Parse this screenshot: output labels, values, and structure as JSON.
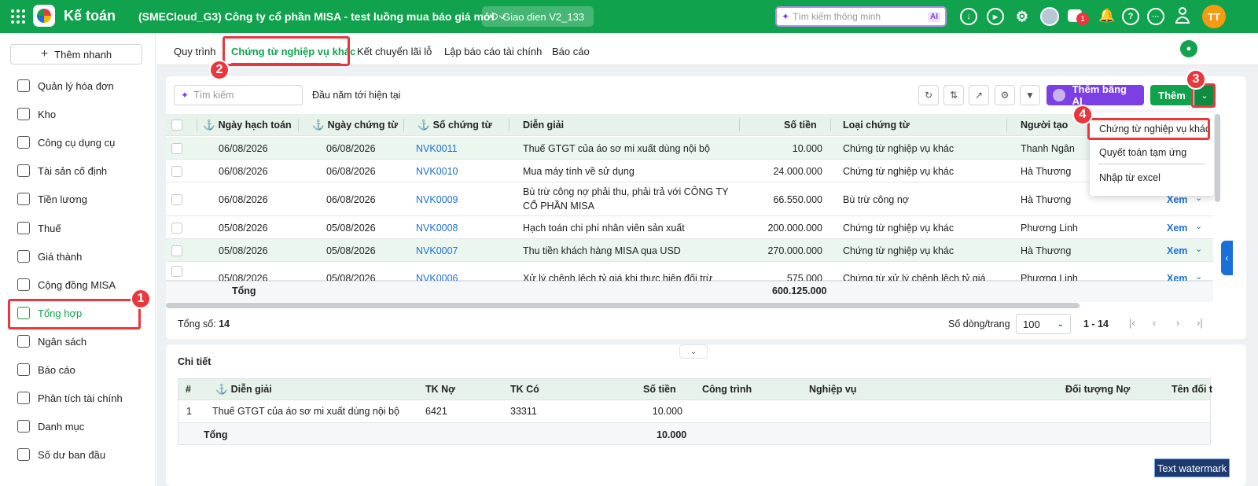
{
  "topbar": {
    "app_title": "Kế toán",
    "company": "(SMECloud_G3) Công ty cổ phần MISA - test luồng mua báo giá mới",
    "version_chip": "Giao dien V2_133",
    "search_placeholder": "Tìm kiếm thông minh",
    "ai_badge": "AI",
    "chat_count": "1",
    "avatar_initials": "TT"
  },
  "sidebar": {
    "quick_add": "Thêm nhanh",
    "items": [
      {
        "label": "Quản lý hóa đơn",
        "icon": "invoice-icon"
      },
      {
        "label": "Kho",
        "icon": "warehouse-icon"
      },
      {
        "label": "Công cụ dụng cụ",
        "icon": "tools-icon"
      },
      {
        "label": "Tài sản cố định",
        "icon": "car-icon"
      },
      {
        "label": "Tiền lương",
        "icon": "dollar-icon"
      },
      {
        "label": "Thuế",
        "icon": "tax-icon"
      },
      {
        "label": "Giá thành",
        "icon": "tag-icon"
      },
      {
        "label": "Cộng đồng MISA",
        "icon": "community-icon"
      },
      {
        "label": "Tổng hợp",
        "icon": "book-icon"
      },
      {
        "label": "Ngân sách",
        "icon": "budget-icon"
      },
      {
        "label": "Báo cáo",
        "icon": "report-icon"
      },
      {
        "label": "Phân tích tài chính",
        "icon": "chart-icon"
      },
      {
        "label": "Danh mục",
        "icon": "list-icon"
      },
      {
        "label": "Số dư ban đầu",
        "icon": "balance-icon"
      }
    ]
  },
  "tabs": [
    "Quy trình",
    "Chứng từ nghiệp vụ khác",
    "Kết chuyển lãi lỗ",
    "Lập báo cáo tài chính",
    "Báo cáo"
  ],
  "toolbar": {
    "search_placeholder": "Tìm kiếm",
    "period": "Đầu năm tới hiện tại",
    "ai_add": "Thêm bằng AI",
    "add": "Thêm"
  },
  "table": {
    "headers": [
      "Ngày hạch toán",
      "Ngày chứng từ",
      "Số chứng từ",
      "Diễn giải",
      "Số tiền",
      "Loại chứng từ",
      "Người tạo"
    ],
    "rows": [
      [
        "06/08/2026",
        "06/08/2026",
        "NVK0011",
        "Thuế GTGT của áo sơ mi xuất dùng nội bộ",
        "",
        "10.000",
        "Chứng từ nghiệp vụ khác",
        "Thanh Ngân"
      ],
      [
        "06/08/2026",
        "06/08/2026",
        "NVK0010",
        "Mua máy tính về sử dụng",
        "",
        "24.000.000",
        "Chứng từ nghiệp vụ khác",
        "Hà Thương"
      ],
      [
        "06/08/2026",
        "06/08/2026",
        "NVK0009",
        "Bù trừ công nợ phải thu, phải trả với CÔNG TY",
        "CỔ PHẦN MISA",
        "66.550.000",
        "Bù trừ công nợ",
        "Hà Thương"
      ],
      [
        "05/08/2026",
        "05/08/2026",
        "NVK0008",
        "Hạch toán chi phí nhân viên sản xuất",
        "",
        "200.000.000",
        "Chứng từ nghiệp vụ khác",
        "Phương Linh"
      ],
      [
        "05/08/2026",
        "05/08/2026",
        "NVK0007",
        "Thu tiền khách hàng MISA qua USD",
        "",
        "270.000.000",
        "Chứng từ nghiệp vụ khác",
        "Hà Thương"
      ],
      [
        "05/08/2026",
        "05/08/2026",
        "NVK0006",
        "Xử lý chênh lệch tỷ giá khi thực hiện đối trừ",
        "",
        "575.000",
        "Chứng từ xử lý chênh lệch tỷ giá",
        "Phương Linh"
      ]
    ],
    "view_label": "Xem",
    "total_label": "Tổng",
    "total_value": "600.125.000"
  },
  "footer": {
    "total_count_label": "Tổng số:",
    "total_count": "14",
    "rows_per_page_label": "Số dòng/trang",
    "rows_per_page": "100",
    "range": "1 - 14"
  },
  "dropdown": [
    "Chứng từ nghiệp vụ khác",
    "Quyết toán tạm ứng",
    "Nhập từ excel"
  ],
  "detail": {
    "title": "Chi tiết",
    "headers": [
      "#",
      "Diễn giải",
      "TK Nợ",
      "TK Có",
      "Số tiền",
      "Công trình",
      "Nghiệp vụ",
      "Đối tượng Nợ",
      "Tên đối t"
    ],
    "row": [
      "1",
      "Thuế GTGT của áo sơ mi xuất dùng nội bộ",
      "6421",
      "33311",
      "10.000"
    ],
    "total_label": "Tổng",
    "total_value": "10.000"
  },
  "annotations": [
    "1",
    "2",
    "3",
    "4"
  ],
  "watermark": "Text watermark",
  "colors": {
    "brand_green": "#11a24d",
    "highlight_red": "#e8383d",
    "ai_purple": "#7b3fe4",
    "link_blue": "#1a6fd8"
  }
}
